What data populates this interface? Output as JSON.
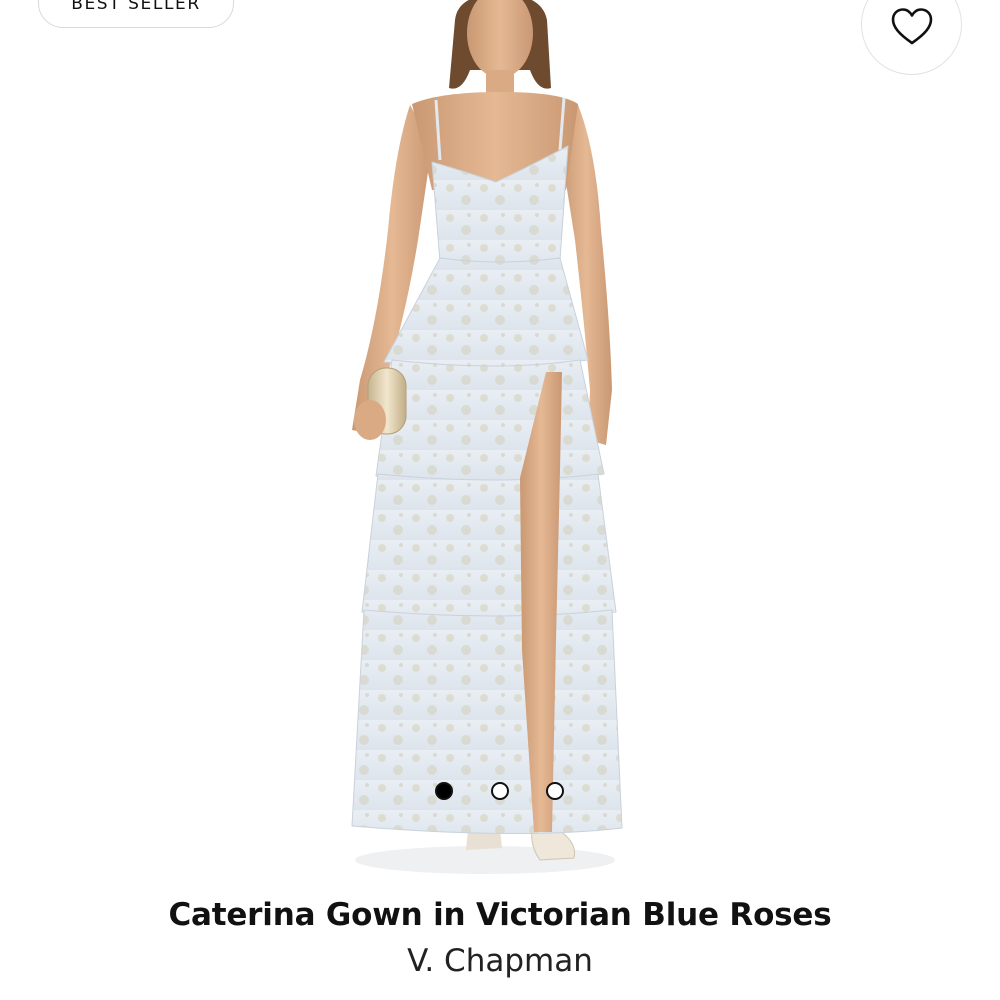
{
  "badge": {
    "label": "BEST SELLER"
  },
  "favorite": {
    "icon": "heart-icon"
  },
  "product": {
    "name": "Caterina Gown in Victorian Blue Roses",
    "brand": "V. Chapman",
    "image": {
      "subject": "model-wearing-tiered-floral-gown"
    }
  },
  "carousel": {
    "slides": 3,
    "active_index": 0
  }
}
